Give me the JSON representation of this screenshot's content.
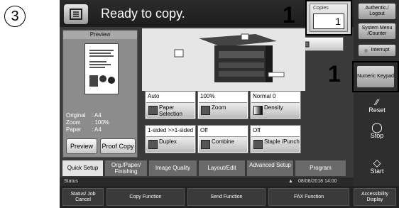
{
  "step_number": "3",
  "callouts": [
    "1",
    "1"
  ],
  "header": {
    "status": "Ready to copy."
  },
  "copies": {
    "label": "Copies",
    "value": "1"
  },
  "preview": {
    "title": "Preview",
    "original_label": "Original",
    "original_value": "A4",
    "zoom_label": "Zoom",
    "zoom_value": "100%",
    "paper_label": "Paper",
    "paper_value": "A4",
    "preview_button": "Preview",
    "proof_copy_button": "Proof Copy"
  },
  "tiles": [
    {
      "value": "Auto",
      "label": "Paper Selection"
    },
    {
      "value": "100%",
      "label": "Zoom"
    },
    {
      "value": "Normal 0",
      "label": "Density"
    },
    {
      "value": "1-sided >>1-sided",
      "label": "Duplex"
    },
    {
      "value": "Off",
      "label": "Combine"
    },
    {
      "value": "Off",
      "label": "Staple /Punch"
    }
  ],
  "tabs": [
    {
      "label": "Quick Setup",
      "active": true
    },
    {
      "label": "Org./Paper/ Finishing",
      "active": false
    },
    {
      "label": "Image Quality",
      "active": false
    },
    {
      "label": "Layout/Edit",
      "active": false
    },
    {
      "label": "Advanced Setup",
      "active": false
    },
    {
      "label": "Program",
      "active": false
    }
  ],
  "status_bar": {
    "label": "Status",
    "datetime": "08/08/2018 14:00"
  },
  "side_panel": {
    "authentic_logout": "Authentic./ Logout",
    "system_menu": "System Menu /Counter",
    "interrupt": "Interrupt",
    "numeric_keypad": "Numeric Keypad",
    "reset": "Reset",
    "stop": "Stop",
    "start": "Start"
  },
  "bottom_bar": {
    "status_job_cancel": "Status/ Job Cancel",
    "copy_function": "Copy Function",
    "send_function": "Send Function",
    "fax_function": "FAX Function",
    "accessibility_display": "Accessibility Display"
  },
  "colors": {
    "screen_bg": "#3a3a3a",
    "accent_blue": "#1f3fa0"
  }
}
